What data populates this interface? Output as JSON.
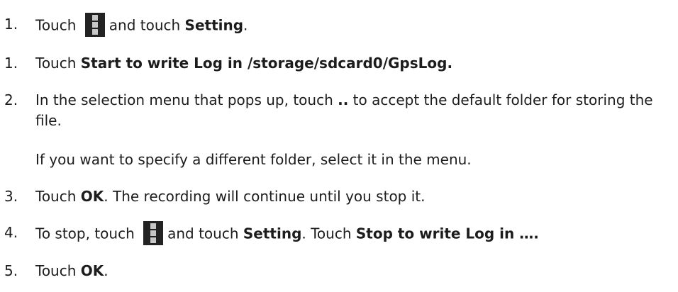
{
  "steps": [
    {
      "number": "1.",
      "parts": [
        "Touch",
        "and touch",
        "Setting",
        "."
      ],
      "icon": "overflow-menu-icon"
    },
    {
      "number": "1.",
      "parts": [
        "Touch",
        "Start to write Log in /storage/sdcard0/GpsLog."
      ]
    },
    {
      "number": "2.",
      "parts": [
        "In the selection menu that pops up, touch",
        "..",
        "to accept the default folder for storing the file."
      ],
      "note": "If you want to specify a different folder, select it in the menu."
    },
    {
      "number": "3.",
      "parts": [
        "Touch",
        "OK",
        ". The recording will continue until you stop it."
      ]
    },
    {
      "number": "4.",
      "parts": [
        "To stop, touch",
        "and touch",
        "Setting",
        ". Touch",
        "Stop to write Log in …."
      ],
      "icon": "overflow-menu-icon"
    },
    {
      "number": "5.",
      "parts": [
        "Touch",
        "OK",
        "."
      ]
    }
  ]
}
